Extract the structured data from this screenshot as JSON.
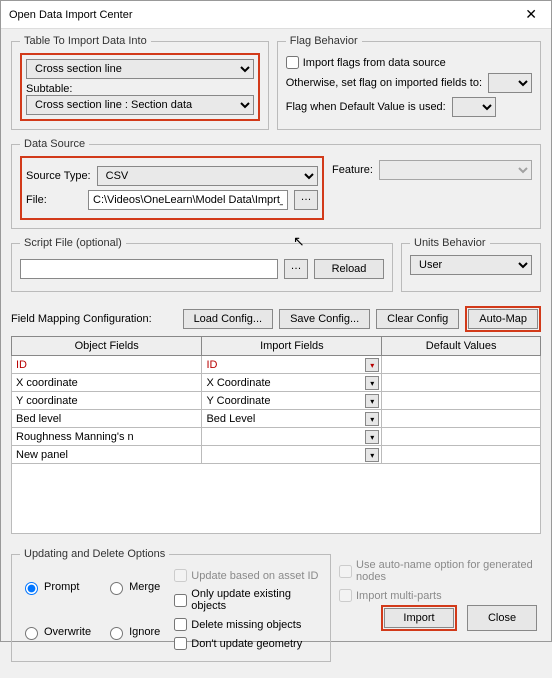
{
  "window": {
    "title": "Open Data Import Center"
  },
  "table_section": {
    "legend": "Table To Import Data Into",
    "table_value": "Cross section line",
    "subtable_label": "Subtable:",
    "subtable_value": "Cross section line : Section data"
  },
  "flag_section": {
    "legend": "Flag Behavior",
    "import_flags": "Import flags from data source",
    "otherwise": "Otherwise, set flag on imported fields to:",
    "default_used": "Flag when Default Value is used:"
  },
  "data_source": {
    "legend": "Data Source",
    "source_type_label": "Source Type:",
    "source_type_value": "CSV",
    "file_label": "File:",
    "file_value": "C:\\Videos\\OneLearn\\Model Data\\Imprt_Srvy",
    "feature_label": "Feature:"
  },
  "script": {
    "legend": "Script File (optional)",
    "reload": "Reload"
  },
  "units": {
    "legend": "Units Behavior",
    "value": "User"
  },
  "config": {
    "label": "Field Mapping Configuration:",
    "load": "Load Config...",
    "save": "Save Config...",
    "clear": "Clear Config",
    "automap": "Auto-Map"
  },
  "mapping": {
    "headers": {
      "obj": "Object Fields",
      "imp": "Import Fields",
      "def": "Default Values"
    },
    "rows": [
      {
        "obj": "ID",
        "imp": "ID",
        "id": true
      },
      {
        "obj": "X coordinate",
        "imp": "X Coordinate"
      },
      {
        "obj": "Y coordinate",
        "imp": "Y Coordinate"
      },
      {
        "obj": "Bed level",
        "imp": "Bed Level"
      },
      {
        "obj": "Roughness Manning's n",
        "imp": ""
      },
      {
        "obj": "New panel",
        "imp": ""
      }
    ]
  },
  "update": {
    "legend": "Updating and Delete Options",
    "prompt": "Prompt",
    "merge": "Merge",
    "overwrite": "Overwrite",
    "ignore": "Ignore",
    "upd_asset": "Update based on asset ID",
    "only_existing": "Only update existing objects",
    "delete_missing": "Delete missing objects",
    "no_geom": "Don't update geometry"
  },
  "extras": {
    "autoname": "Use auto-name option for generated nodes",
    "multiparts": "Import multi-parts"
  },
  "footer": {
    "import": "Import",
    "close": "Close"
  }
}
